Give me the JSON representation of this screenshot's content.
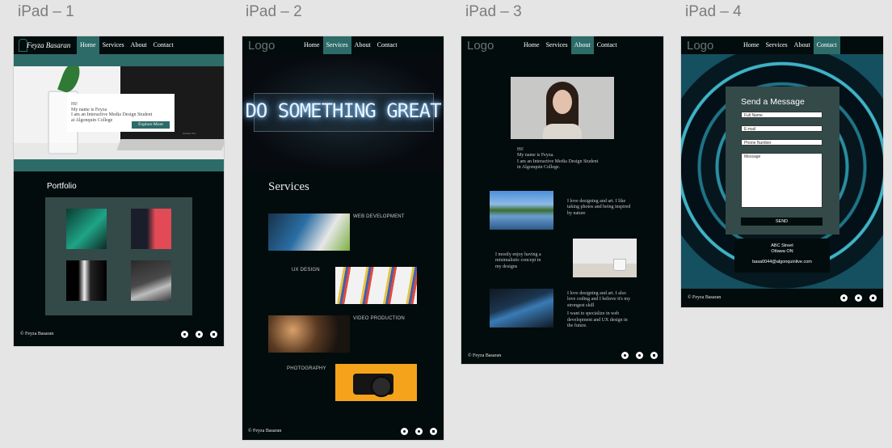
{
  "frames": [
    {
      "name": "iPad – 1",
      "nav": [
        "Home",
        "Services",
        "About",
        "Contact"
      ],
      "active": "Home",
      "brand": "Feyza Basaran",
      "hero": {
        "line1": "Hi!",
        "line2": "My name is Feyza",
        "line3": "I am an Interactive Media Design Student",
        "line4": "at Algonquin College",
        "cta": "Explore More",
        "tag": "Nadiaet Ew"
      },
      "section": "Portfolio",
      "footer": "© Feyza Basaran"
    },
    {
      "name": "iPad – 2",
      "logo": "Logo",
      "nav": [
        "Home",
        "Services",
        "About",
        "Contact"
      ],
      "active": "Services",
      "neon": "DO SOMETHING GREAT",
      "section": "Services",
      "services": [
        "WEB DEVELOPMENT",
        "UX DESIGN",
        "VIDEO PRODUCTION",
        "PHOTOGRAPHY"
      ],
      "footer": "© Feyza Basaran"
    },
    {
      "name": "iPad – 3",
      "logo": "Logo",
      "nav": [
        "Home",
        "Services",
        "About",
        "Contact"
      ],
      "active": "About",
      "intro": {
        "l1": "Hi!",
        "l2": "My name is Feyza.",
        "l3": "I am an Interactive Media Design Student",
        "l4": "in Algonquin College."
      },
      "p1": {
        "l1": "I love designing and art. I like",
        "l2": "taking photos and being inspired",
        "l3": "by nature"
      },
      "p2": {
        "l1": "I mostly enjoy having a",
        "l2": "minimalistic concept in",
        "l3": "my designs"
      },
      "p3": {
        "l1": "I love designing and art. I also",
        "l2": "love coding and I believe it's my",
        "l3": "strongest skill",
        "l4": "I want to specialize in web",
        "l5": "development and UX design in",
        "l6": "the future."
      },
      "footer": "© Feyza Basaran"
    },
    {
      "name": "iPad – 4",
      "logo": "Logo",
      "nav": [
        "Home",
        "Services",
        "About",
        "Contact"
      ],
      "active": "Contact",
      "form": {
        "title": "Send a Message",
        "fields": [
          "Full Name",
          "E-mail",
          "Phone Number"
        ],
        "message": "Message",
        "send": "SEND"
      },
      "address": {
        "l1": "ABC Street",
        "l2": "Ottawa ON",
        "email": "basa0044@algonquinlive.com"
      },
      "footer": "© Feyza Basaran"
    }
  ],
  "colors": {
    "bg": "#030c0c",
    "accent": "#2d6b68",
    "panel": "#344a48"
  }
}
